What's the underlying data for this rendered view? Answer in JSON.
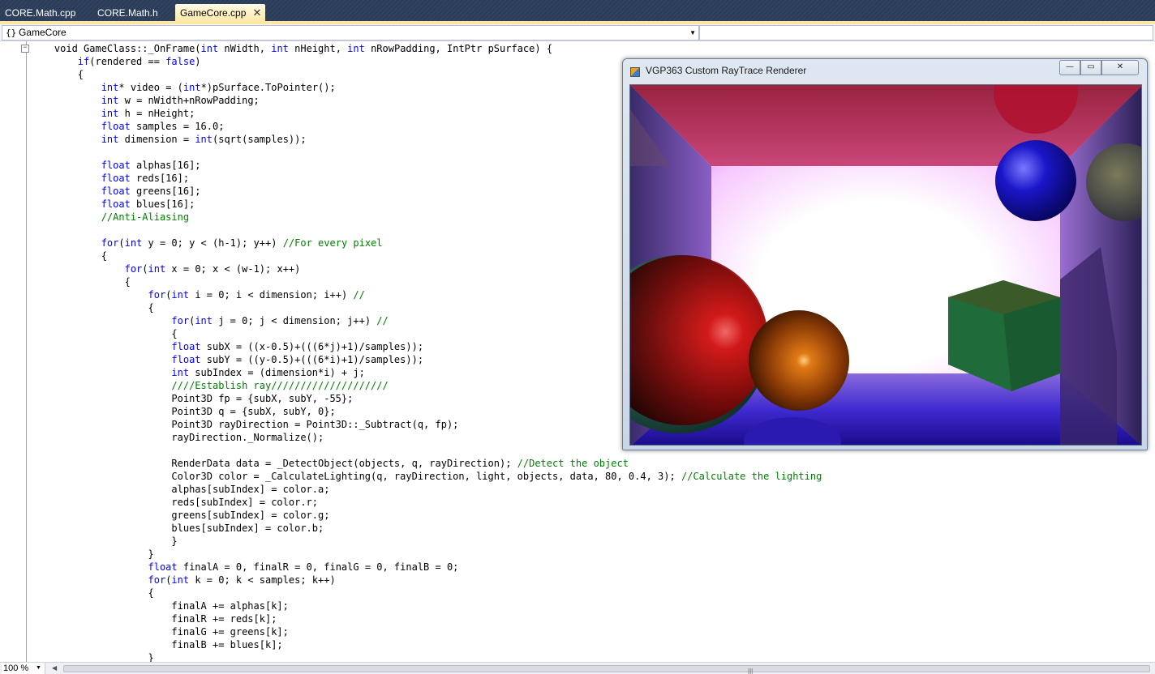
{
  "tabs": [
    {
      "label": "CORE.Math.cpp",
      "active": false
    },
    {
      "label": "CORE.Math.h",
      "active": false
    },
    {
      "label": "GameCore.cpp",
      "active": true
    }
  ],
  "tab_close_symbol": "✕",
  "scope": {
    "icon": "{}",
    "label": "GameCore"
  },
  "code_lines": [
    [
      [
        "    void GameClass::_OnFrame(",
        ""
      ],
      [
        "int",
        "kw"
      ],
      [
        " nWidth, ",
        ""
      ],
      [
        "int",
        "kw"
      ],
      [
        " nHeight, ",
        ""
      ],
      [
        "int",
        "kw"
      ],
      [
        " nRowPadding, IntPtr pSurface) {",
        ""
      ]
    ],
    [
      [
        "        ",
        ""
      ],
      [
        "if",
        "kw"
      ],
      [
        "(rendered == ",
        ""
      ],
      [
        "false",
        "kw"
      ],
      [
        ")",
        ""
      ]
    ],
    [
      [
        "        {",
        ""
      ]
    ],
    [
      [
        "            ",
        ""
      ],
      [
        "int",
        "kw"
      ],
      [
        "* video = (",
        ""
      ],
      [
        "int",
        "kw"
      ],
      [
        "*)pSurface.ToPointer();",
        ""
      ]
    ],
    [
      [
        "            ",
        ""
      ],
      [
        "int",
        "kw"
      ],
      [
        " w = nWidth+nRowPadding;",
        ""
      ]
    ],
    [
      [
        "            ",
        ""
      ],
      [
        "int",
        "kw"
      ],
      [
        " h = nHeight;",
        ""
      ]
    ],
    [
      [
        "            ",
        ""
      ],
      [
        "float",
        "kw"
      ],
      [
        " samples = 16.0;",
        ""
      ]
    ],
    [
      [
        "            ",
        ""
      ],
      [
        "int",
        "kw"
      ],
      [
        " dimension = ",
        ""
      ],
      [
        "int",
        "kw"
      ],
      [
        "(sqrt(samples));",
        ""
      ]
    ],
    [
      [
        "",
        ""
      ]
    ],
    [
      [
        "            ",
        ""
      ],
      [
        "float",
        "kw"
      ],
      [
        " alphas[16];",
        ""
      ]
    ],
    [
      [
        "            ",
        ""
      ],
      [
        "float",
        "kw"
      ],
      [
        " reds[16];",
        ""
      ]
    ],
    [
      [
        "            ",
        ""
      ],
      [
        "float",
        "kw"
      ],
      [
        " greens[16];",
        ""
      ]
    ],
    [
      [
        "            ",
        ""
      ],
      [
        "float",
        "kw"
      ],
      [
        " blues[16];",
        ""
      ]
    ],
    [
      [
        "            ",
        ""
      ],
      [
        "//Anti-Aliasing",
        "cm"
      ]
    ],
    [
      [
        "",
        ""
      ]
    ],
    [
      [
        "            ",
        ""
      ],
      [
        "for",
        "kw"
      ],
      [
        "(",
        ""
      ],
      [
        "int",
        "kw"
      ],
      [
        " y = 0; y < (h-1); y++) ",
        ""
      ],
      [
        "//For every pixel",
        "cm"
      ]
    ],
    [
      [
        "            {",
        ""
      ]
    ],
    [
      [
        "                ",
        ""
      ],
      [
        "for",
        "kw"
      ],
      [
        "(",
        ""
      ],
      [
        "int",
        "kw"
      ],
      [
        " x = 0; x < (w-1); x++)",
        ""
      ]
    ],
    [
      [
        "                {",
        ""
      ]
    ],
    [
      [
        "                    ",
        ""
      ],
      [
        "for",
        "kw"
      ],
      [
        "(",
        ""
      ],
      [
        "int",
        "kw"
      ],
      [
        " i = 0; i < dimension; i++) ",
        ""
      ],
      [
        "//",
        "cm"
      ]
    ],
    [
      [
        "                    {",
        ""
      ]
    ],
    [
      [
        "                        ",
        ""
      ],
      [
        "for",
        "kw"
      ],
      [
        "(",
        ""
      ],
      [
        "int",
        "kw"
      ],
      [
        " j = 0; j < dimension; j++) ",
        ""
      ],
      [
        "//",
        "cm"
      ]
    ],
    [
      [
        "                        {",
        ""
      ]
    ],
    [
      [
        "                        ",
        ""
      ],
      [
        "float",
        "kw"
      ],
      [
        " subX = ((x-0.5)+(((6*j)+1)/samples));",
        ""
      ]
    ],
    [
      [
        "                        ",
        ""
      ],
      [
        "float",
        "kw"
      ],
      [
        " subY = ((y-0.5)+(((6*i)+1)/samples));",
        ""
      ]
    ],
    [
      [
        "                        ",
        ""
      ],
      [
        "int",
        "kw"
      ],
      [
        " subIndex = (dimension*i) + j;",
        ""
      ]
    ],
    [
      [
        "                        ",
        ""
      ],
      [
        "////Establish ray////////////////////",
        "cm"
      ]
    ],
    [
      [
        "                        Point3D fp = {subX, subY, -55};",
        ""
      ]
    ],
    [
      [
        "                        Point3D q = {subX, subY, 0};",
        ""
      ]
    ],
    [
      [
        "                        Point3D rayDirection = Point3D::_Subtract(q, fp);",
        ""
      ]
    ],
    [
      [
        "                        rayDirection._Normalize();",
        ""
      ]
    ],
    [
      [
        "",
        ""
      ]
    ],
    [
      [
        "                        RenderData data = _DetectObject(objects, q, rayDirection); ",
        ""
      ],
      [
        "//Detect the object",
        "cm"
      ]
    ],
    [
      [
        "                        Color3D color = _CalculateLighting(q, rayDirection, light, objects, data, 80, 0.4, 3); ",
        ""
      ],
      [
        "//Calculate the lighting",
        "cm"
      ]
    ],
    [
      [
        "                        alphas[subIndex] = color.a;",
        ""
      ]
    ],
    [
      [
        "                        reds[subIndex] = color.r;",
        ""
      ]
    ],
    [
      [
        "                        greens[subIndex] = color.g;",
        ""
      ]
    ],
    [
      [
        "                        blues[subIndex] = color.b;",
        ""
      ]
    ],
    [
      [
        "                        }",
        ""
      ]
    ],
    [
      [
        "                    }",
        ""
      ]
    ],
    [
      [
        "                    ",
        ""
      ],
      [
        "float",
        "kw"
      ],
      [
        " finalA = 0, finalR = 0, finalG = 0, finalB = 0;",
        ""
      ]
    ],
    [
      [
        "                    ",
        ""
      ],
      [
        "for",
        "kw"
      ],
      [
        "(",
        ""
      ],
      [
        "int",
        "kw"
      ],
      [
        " k = 0; k < samples; k++)",
        ""
      ]
    ],
    [
      [
        "                    {",
        ""
      ]
    ],
    [
      [
        "                        finalA += alphas[k];",
        ""
      ]
    ],
    [
      [
        "                        finalR += reds[k];",
        ""
      ]
    ],
    [
      [
        "                        finalG += greens[k];",
        ""
      ]
    ],
    [
      [
        "                        finalB += blues[k];",
        ""
      ]
    ],
    [
      [
        "                    }",
        ""
      ]
    ]
  ],
  "fold_symbol": "−",
  "statusbar": {
    "zoom": "100 %",
    "grip": "|||"
  },
  "render_window": {
    "title": "VGP363 Custom RayTrace Renderer",
    "minimize_glyph": "—",
    "maximize_glyph": "▭",
    "close_glyph": "✕"
  },
  "colors": {
    "tab_strip_bg": "#2b3c59",
    "active_tab_bg": "#ffe8a6",
    "keyword": "#0000ff",
    "comment": "#008000",
    "text": "#000000"
  }
}
